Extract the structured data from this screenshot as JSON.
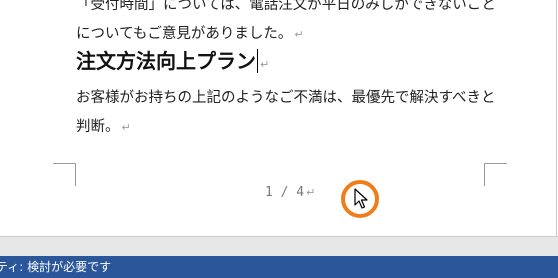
{
  "document": {
    "paragraph_1_line_1": "「受付時間」については、電話注文が平日のみしかできないこと",
    "paragraph_1_line_2": "についてもご意見がありました。",
    "heading": "注文方法向上プラン",
    "paragraph_2_line_1": "お客様がお持ちの上記のようなご不満は、最優先で解決すべきと",
    "paragraph_2_line_2": "判断。",
    "paragraph_mark": "↵"
  },
  "footer": {
    "page_number": "1 / 4"
  },
  "status_bar": {
    "accessibility": "ティ: 検討が必要です"
  },
  "icons": {
    "pointer": "mouse-pointer-icon",
    "click_marker": "click-highlight-circle"
  },
  "colors": {
    "status_bar_background": "#2b579a",
    "click_highlight": "#f07d1a",
    "paragraph_mark": "#9a9a9a"
  }
}
